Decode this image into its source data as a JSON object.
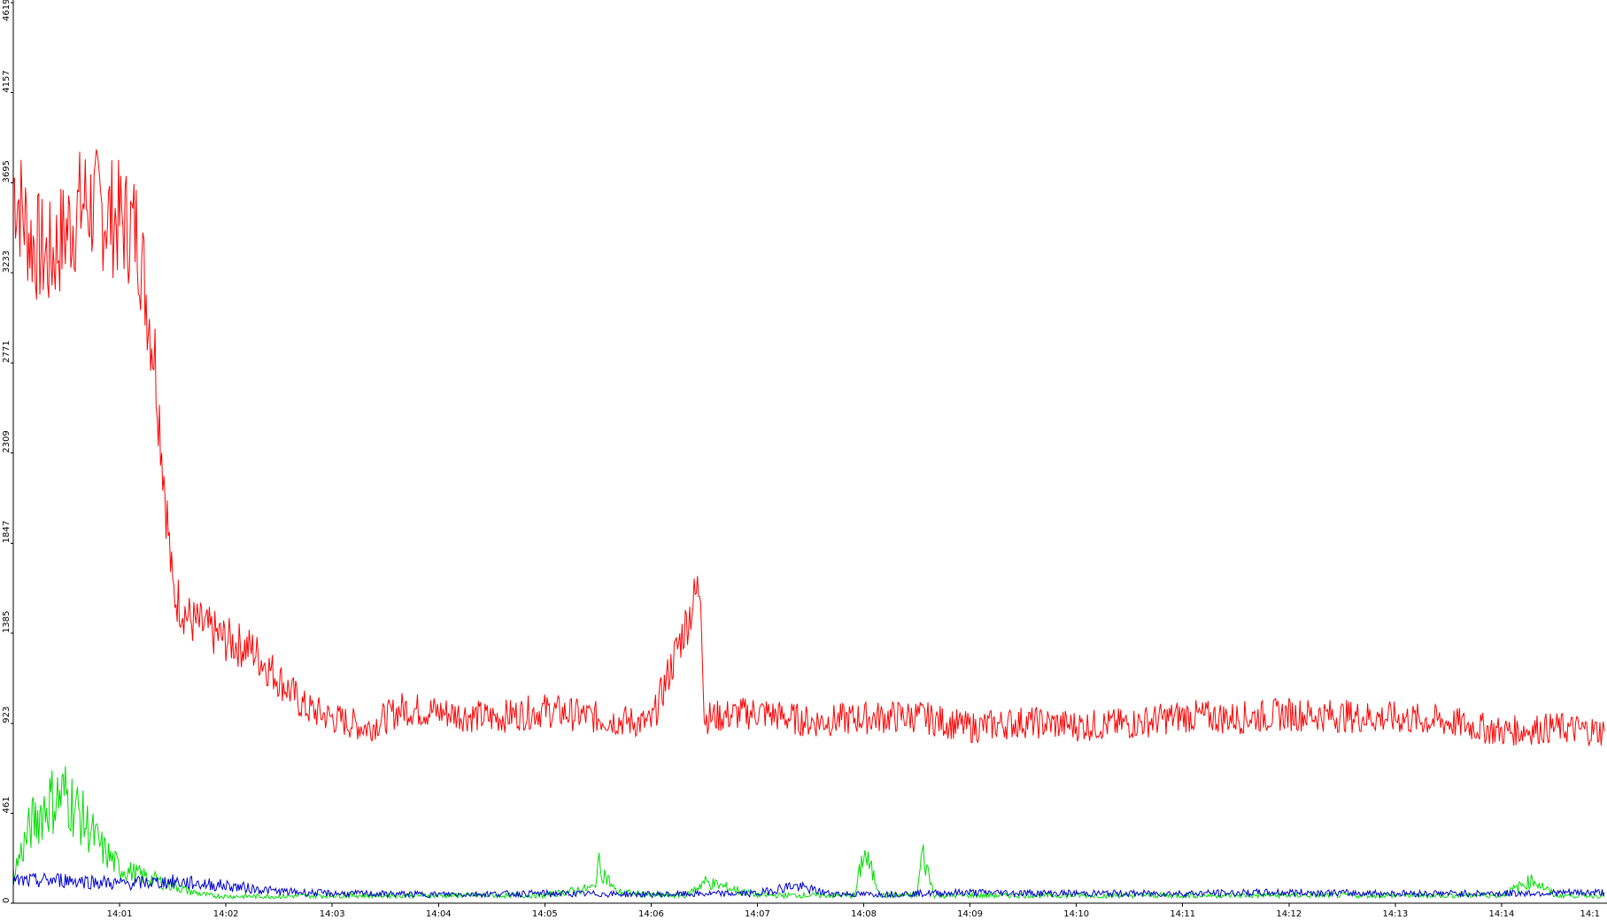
{
  "chart_data": {
    "type": "line",
    "title": "",
    "xlabel": "",
    "ylabel": "",
    "ylim": [
      0,
      4619
    ],
    "yticks": [
      "0",
      "461",
      "923",
      "1385",
      "1847",
      "2309",
      "2771",
      "3233",
      "3695",
      "4157",
      "4619"
    ],
    "xlim": [
      "14:00:00",
      "14:14:58"
    ],
    "xticks": [
      "14:01",
      "14:02",
      "14:03",
      "14:04",
      "14:05",
      "14:06",
      "14:07",
      "14:08",
      "14:09",
      "14:10",
      "14:11",
      "14:12",
      "14:13",
      "14:14",
      "14:1"
    ],
    "grid": false,
    "legend": "none",
    "series": [
      {
        "color": "#ff0000",
        "x": [
          "14:00:00",
          "14:00:10",
          "14:00:20",
          "14:00:30",
          "14:00:40",
          "14:00:50",
          "14:01:00",
          "14:01:10",
          "14:01:20",
          "14:01:30",
          "14:01:40",
          "14:01:50",
          "14:02:00",
          "14:02:15",
          "14:02:30",
          "14:02:45",
          "14:03:00",
          "14:03:20",
          "14:03:40",
          "14:04:00",
          "14:04:30",
          "14:05:00",
          "14:05:30",
          "14:06:00",
          "14:06:28",
          "14:06:30",
          "14:07:00",
          "14:07:30",
          "14:08:00",
          "14:08:30",
          "14:09:00",
          "14:09:30",
          "14:10:00",
          "14:10:30",
          "14:11:00",
          "14:11:30",
          "14:12:00",
          "14:12:30",
          "14:13:00",
          "14:13:30",
          "14:14:00",
          "14:14:30",
          "14:14:58"
        ],
        "y": [
          3700,
          3400,
          3300,
          3450,
          3600,
          3550,
          3500,
          3450,
          2800,
          1600,
          1450,
          1400,
          1350,
          1300,
          1150,
          1000,
          950,
          900,
          1000,
          980,
          950,
          990,
          950,
          920,
          1650,
          950,
          980,
          930,
          950,
          960,
          900,
          930,
          910,
          920,
          960,
          950,
          970,
          960,
          950,
          930,
          880,
          900,
          880
        ]
      },
      {
        "color": "#00dd00",
        "x": [
          "14:00:00",
          "14:00:10",
          "14:00:20",
          "14:00:30",
          "14:00:40",
          "14:00:50",
          "14:01:00",
          "14:01:10",
          "14:01:20",
          "14:01:30",
          "14:01:40",
          "14:01:50",
          "14:02:00",
          "14:02:30",
          "14:03:00",
          "14:04:00",
          "14:05:00",
          "14:05:28",
          "14:05:30",
          "14:05:40",
          "14:06:00",
          "14:06:20",
          "14:06:30",
          "14:07:00",
          "14:07:30",
          "14:07:55",
          "14:08:00",
          "14:08:10",
          "14:08:30",
          "14:08:33",
          "14:08:40",
          "14:09:00",
          "14:10:00",
          "14:11:00",
          "14:12:00",
          "14:13:00",
          "14:14:00",
          "14:14:18",
          "14:14:30",
          "14:14:58"
        ],
        "y": [
          150,
          400,
          520,
          560,
          420,
          280,
          180,
          150,
          120,
          90,
          60,
          40,
          35,
          35,
          40,
          40,
          40,
          80,
          200,
          60,
          40,
          40,
          110,
          40,
          40,
          40,
          260,
          40,
          40,
          260,
          40,
          40,
          40,
          40,
          40,
          40,
          40,
          120,
          40,
          40
        ]
      },
      {
        "color": "#0000cc",
        "x": [
          "14:00:00",
          "14:00:30",
          "14:01:00",
          "14:01:30",
          "14:02:00",
          "14:02:30",
          "14:03:00",
          "14:04:00",
          "14:05:00",
          "14:06:00",
          "14:07:00",
          "14:07:20",
          "14:07:40",
          "14:08:00",
          "14:09:00",
          "14:10:00",
          "14:11:00",
          "14:12:00",
          "14:13:00",
          "14:14:00",
          "14:14:58"
        ],
        "y": [
          110,
          120,
          100,
          110,
          90,
          60,
          50,
          45,
          50,
          45,
          50,
          90,
          50,
          45,
          55,
          50,
          50,
          55,
          50,
          50,
          55
        ]
      }
    ]
  }
}
